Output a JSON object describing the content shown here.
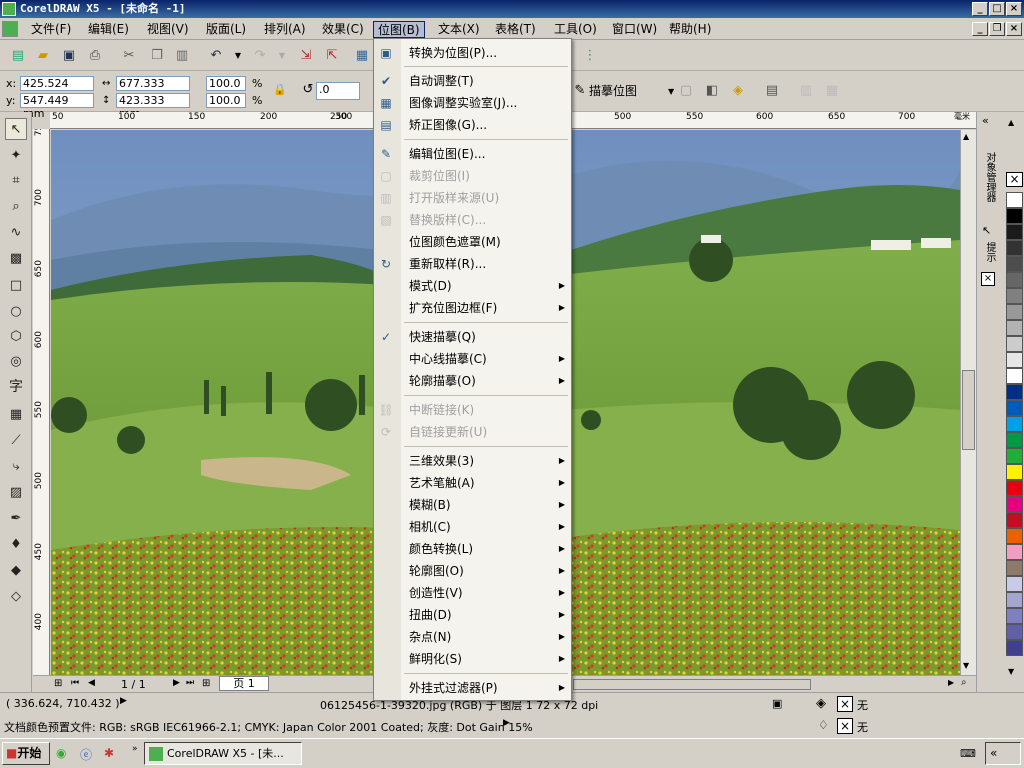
{
  "window": {
    "title": "CorelDRAW X5 - [未命名 -1]"
  },
  "menubar": {
    "items": [
      "文件(F)",
      "编辑(E)",
      "视图(V)",
      "版面(L)",
      "排列(A)",
      "效果(C)",
      "位图(B)",
      "文本(X)",
      "表格(T)",
      "工具(O)",
      "窗口(W)",
      "帮助(H)"
    ],
    "active_index": 6
  },
  "propbar": {
    "x_label": "x:",
    "x_value": "425.524 mm",
    "y_label": "y:",
    "y_value": "547.449 mm",
    "w_value": "677.333 mm",
    "h_value": "423.333 mm",
    "scale_x": "100.0",
    "scale_y": "100.0",
    "pct": "%",
    "rotation": ".0",
    "trace_label": "描摹位图"
  },
  "ruler_top": [
    "50",
    "100",
    "150",
    "200",
    "250",
    "300",
    "500",
    "550",
    "600",
    "650",
    "700",
    "毫米"
  ],
  "ruler_left": [
    "750",
    "700",
    "650",
    "600",
    "550",
    "500",
    "450",
    "400"
  ],
  "bitmap_menu": {
    "items": [
      {
        "label": "转换为位图(P)...",
        "disabled": false,
        "submenu": false,
        "icon": "convert-bitmap-icon"
      },
      {
        "label": "自动调整(T)",
        "disabled": false,
        "submenu": false,
        "icon": "auto-adjust-icon"
      },
      {
        "label": "图像调整实验室(J)...",
        "disabled": false,
        "submenu": false,
        "icon": "image-lab-icon"
      },
      {
        "label": "矫正图像(G)...",
        "disabled": false,
        "submenu": false,
        "icon": "straighten-icon"
      },
      {
        "label": "编辑位图(E)...",
        "disabled": false,
        "submenu": false,
        "icon": "edit-bitmap-icon"
      },
      {
        "label": "裁剪位图(I)",
        "disabled": true,
        "submenu": false,
        "icon": "crop-bitmap-icon"
      },
      {
        "label": "打开版样来源(U)",
        "disabled": true,
        "submenu": false,
        "icon": "open-source-icon"
      },
      {
        "label": "替换版样(C)...",
        "disabled": true,
        "submenu": false,
        "icon": "replace-icon"
      },
      {
        "label": "位图颜色遮罩(M)",
        "disabled": false,
        "submenu": false,
        "icon": ""
      },
      {
        "label": "重新取样(R)...",
        "disabled": false,
        "submenu": false,
        "icon": "resample-icon"
      },
      {
        "label": "模式(D)",
        "disabled": false,
        "submenu": true,
        "icon": ""
      },
      {
        "label": "扩充位图边框(F)",
        "disabled": false,
        "submenu": true,
        "icon": ""
      },
      {
        "label": "快速描摹(Q)",
        "disabled": false,
        "submenu": false,
        "icon": "quick-trace-icon"
      },
      {
        "label": "中心线描摹(C)",
        "disabled": false,
        "submenu": true,
        "icon": ""
      },
      {
        "label": "轮廓描摹(O)",
        "disabled": false,
        "submenu": true,
        "icon": ""
      },
      {
        "label": "中断链接(K)",
        "disabled": true,
        "submenu": false,
        "icon": "break-link-icon"
      },
      {
        "label": "自链接更新(U)",
        "disabled": true,
        "submenu": false,
        "icon": "update-link-icon"
      },
      {
        "label": "三维效果(3)",
        "disabled": false,
        "submenu": true,
        "icon": ""
      },
      {
        "label": "艺术笔触(A)",
        "disabled": false,
        "submenu": true,
        "icon": ""
      },
      {
        "label": "模糊(B)",
        "disabled": false,
        "submenu": true,
        "icon": ""
      },
      {
        "label": "相机(C)",
        "disabled": false,
        "submenu": true,
        "icon": ""
      },
      {
        "label": "颜色转换(L)",
        "disabled": false,
        "submenu": true,
        "icon": ""
      },
      {
        "label": "轮廓图(O)",
        "disabled": false,
        "submenu": true,
        "icon": ""
      },
      {
        "label": "创造性(V)",
        "disabled": false,
        "submenu": true,
        "icon": ""
      },
      {
        "label": "扭曲(D)",
        "disabled": false,
        "submenu": true,
        "icon": ""
      },
      {
        "label": "杂点(N)",
        "disabled": false,
        "submenu": true,
        "icon": ""
      },
      {
        "label": "鲜明化(S)",
        "disabled": false,
        "submenu": true,
        "icon": ""
      },
      {
        "label": "外挂式过滤器(P)",
        "disabled": false,
        "submenu": true,
        "icon": ""
      }
    ]
  },
  "pagenav": {
    "page_count": "1 / 1",
    "page_tab": "页 1"
  },
  "status": {
    "coords": "( 336.624, 710.432 )",
    "file_info": "06125456-1-39320.jpg (RGB) 于 图层 1 72 x 72 dpi",
    "color_profile": "文档颜色预置文件: RGB: sRGB IEC61966-2.1; CMYK: Japan Color 2001 Coated; 灰度: Dot Gain 15%",
    "fill_label": "无",
    "outline_label": "无"
  },
  "taskbar": {
    "start_label": "开始",
    "task_label": "CorelDRAW X5 - [未..."
  },
  "dock": {
    "object_manager": "对象管理器",
    "hints": "提示"
  },
  "palette_colors": [
    "#ffffff",
    "#000000",
    "#1a1a1a",
    "#333333",
    "#4d4d4d",
    "#666666",
    "#808080",
    "#999999",
    "#b3b3b3",
    "#cccccc",
    "#e6e6e6",
    "#ffffff",
    "#002f87",
    "#005bbb",
    "#00a0e9",
    "#009944",
    "#22ac38",
    "#fff100",
    "#e60012",
    "#e4007f",
    "#c30d23",
    "#eb6100",
    "#f19ec2",
    "#8f7a6a",
    "#c9c9e8",
    "#a5a5d2",
    "#8080c0",
    "#6060a8",
    "#404090"
  ]
}
